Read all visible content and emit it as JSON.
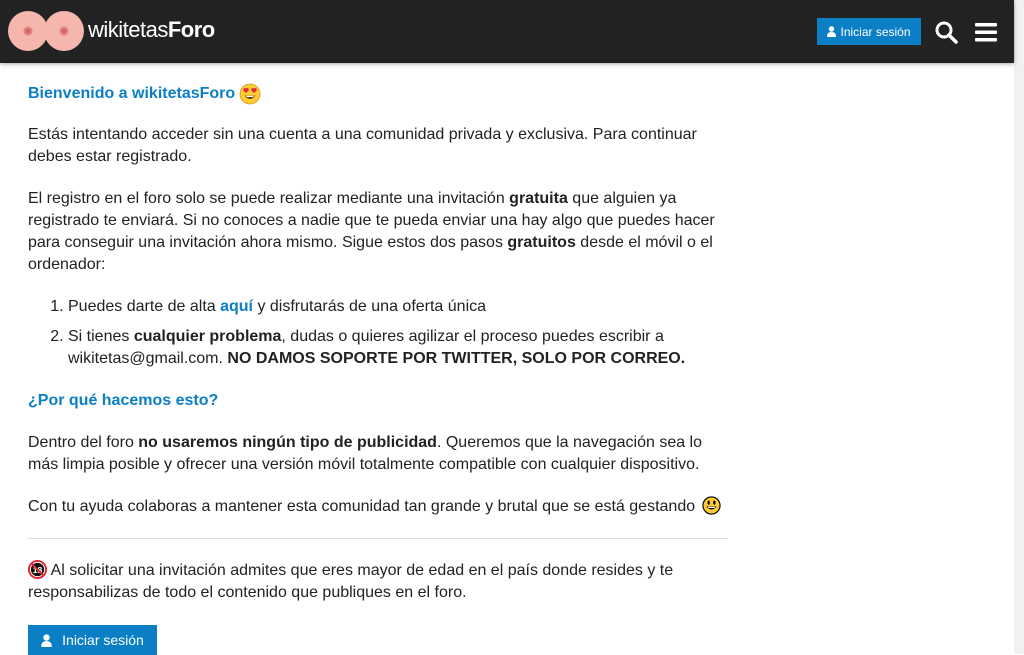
{
  "header": {
    "logo_text_thin": "wikitetas",
    "logo_text_bold": "Foro",
    "login_label": "Iniciar sesión",
    "bg_color": "#222222",
    "accent_color": "#0b7fc6",
    "icons": [
      "user-icon",
      "search-icon",
      "hamburger-menu-icon"
    ]
  },
  "main": {
    "welcome_title": "Bienvenido a wikitetasForo",
    "intro": "Estás intentando acceder sin una cuenta a una comunidad privada y exclusiva. Para continuar debes estar registrado.",
    "registration": {
      "part1": "El registro en el foro solo se puede realizar mediante una invitación ",
      "bold1": "gratuita",
      "part2": " que alguien ya registrado te enviará. Si no conoces a nadie que te pueda enviar una hay algo que puedes hacer para conseguir una invitación ahora mismo. Sigue estos dos pasos ",
      "bold2": "gratuitos",
      "part3": " desde el móvil o el ordenador:"
    },
    "steps": [
      {
        "pre": "Puedes darte de alta ",
        "link": "aquí",
        "post": " y disfrutarás de una oferta única"
      },
      {
        "pre": "Si tienes ",
        "bold": "cualquier problema",
        "mid": ", dudas o quieres agilizar el proceso puedes escribir a wikitetas@gmail.com. ",
        "bold2": "NO DAMOS SOPORTE POR TWITTER, SOLO POR CORREO."
      }
    ],
    "why_title": "¿Por qué hacemos esto?",
    "why": {
      "pre": "Dentro del foro ",
      "bold": "no usaremos ningún tipo de publicidad",
      "post": ". Queremos que la navegación sea lo más limpia posible y ofrecer una versión móvil totalmente compatible con cualquier dispositivo."
    },
    "support_text": "Con tu ayuda colaboras a mantener esta comunidad tan grande y brutal que se está gestando",
    "age_notice": "Al solicitar una invitación admites que eres mayor de edad en el país donde resides y te responsabilizas de todo el contenido que publiques en el foro.",
    "login_button_label": "Iniciar sesión",
    "icons": [
      "heart-eyes-emoji-icon",
      "grinning-emoji-icon",
      "no-under-18-icon",
      "user-icon"
    ]
  }
}
